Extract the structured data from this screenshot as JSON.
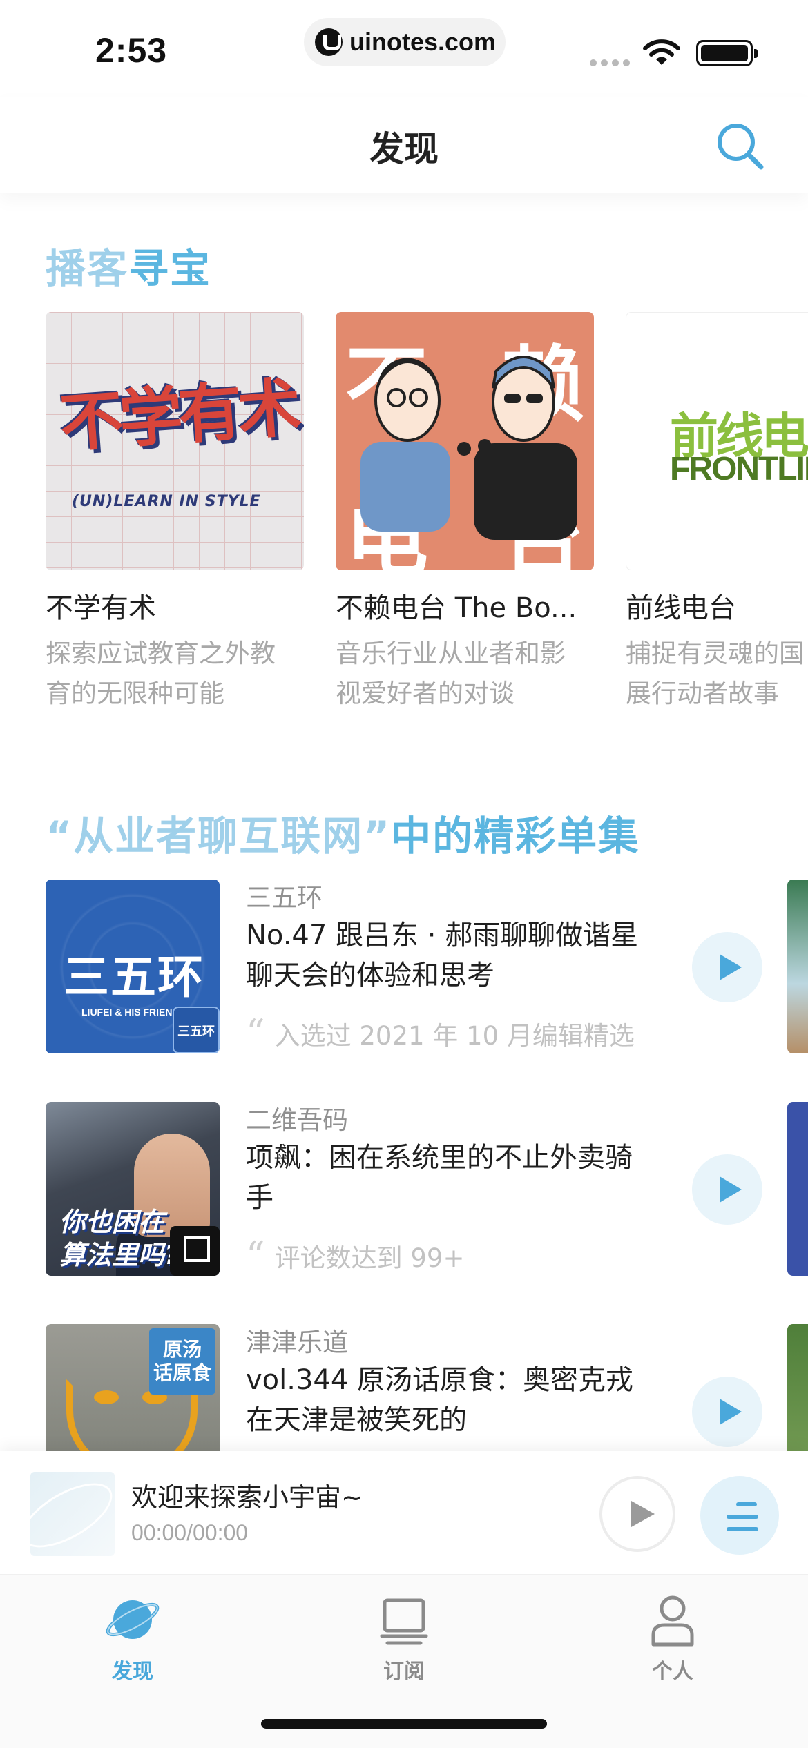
{
  "status_bar": {
    "time": "2:53",
    "url": "uinotes.com"
  },
  "nav": {
    "title": "发现",
    "search_icon": "search-icon"
  },
  "colors": {
    "accent": "#4aa8db",
    "section_title": "#5bb6e0",
    "muted_text": "#a8a8a8"
  },
  "section_discover": {
    "title_light": "播客",
    "title_strong": "寻宝"
  },
  "podcasts": [
    {
      "name": "不学有术",
      "desc_line1": "探索应试教育之外教",
      "desc_line2": "育的无限种可能",
      "cover_text": "不学有术",
      "cover_subtext": "(UN)LEARN IN STYLE"
    },
    {
      "name": "不赖电台 The Bo...",
      "desc_line1": "音乐行业从业者和影",
      "desc_line2": "视爱好者的对谈",
      "cover_chars": [
        "不",
        "赖",
        "电",
        "台"
      ]
    },
    {
      "name": "前线电台",
      "desc_line1": "捕捉有灵魂的国",
      "desc_line2": "展行动者故事",
      "cover_text": "前线电台",
      "cover_subtext": "FRONTLINE"
    }
  ],
  "section_episodes": {
    "title_light": "“从业者聊互联网”",
    "title_strong": "中的精彩单集"
  },
  "episodes": [
    {
      "podcast": "三五环",
      "title_line1": "No.47 跟吕东 · 郝雨聊聊做谐星",
      "title_line2": "聊天会的体验和思考",
      "quote": "入选过 2021 年 10 月编辑精选",
      "cover_text": "三五环",
      "cover_subtext": "LIUFEI & HIS FRIENDS",
      "badge_text": "三五环"
    },
    {
      "podcast": "二维吾码",
      "title_line1": "项飙：困在系统里的不止外卖骑",
      "title_line2": "手",
      "quote": "评论数达到 99+",
      "cover_line1": "你也困在",
      "cover_line2": "算法里吗?"
    },
    {
      "podcast": "津津乐道",
      "title_line1": "vol.344 原汤话原食：奥密克戎",
      "title_line2": "在天津是被笑死的",
      "quote": "",
      "badge_line1": "原汤",
      "badge_line2": "话原食"
    }
  ],
  "mini_player": {
    "title": "欢迎来探索小宇宙~",
    "time": "00:00/00:00"
  },
  "tabs": [
    {
      "label": "发现",
      "icon": "planet-icon",
      "active": true
    },
    {
      "label": "订阅",
      "icon": "subscribe-icon",
      "active": false
    },
    {
      "label": "个人",
      "icon": "person-icon",
      "active": false
    }
  ]
}
